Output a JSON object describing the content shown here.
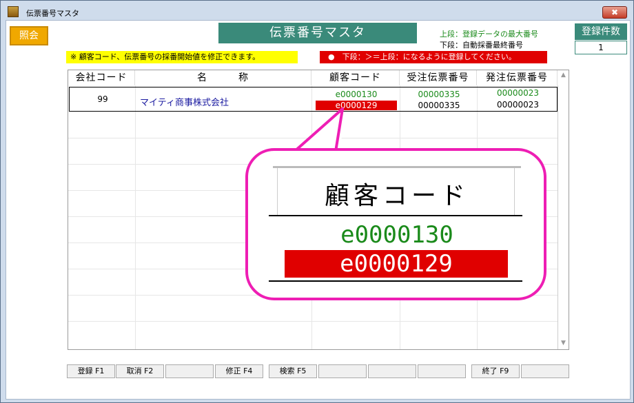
{
  "window": {
    "title": "伝票番号マスタ",
    "close_label": "✖"
  },
  "toolbar": {
    "shokai_label": "照会"
  },
  "header": {
    "title": "伝票番号マスタ",
    "legend_top": "上段：登録データの最大番号",
    "legend_bottom": "下段：自動採番最終番号",
    "count_label": "登録件数",
    "count_value": "1"
  },
  "notes": {
    "yellow": "※ 顧客コード、伝票番号の採番開始値を修正できます。",
    "red": "●　下段：＞＝上段：になるように登録してください。"
  },
  "table": {
    "columns": [
      "会社コード",
      "名　　　称",
      "顧客コード",
      "受注伝票番号",
      "発注伝票番号"
    ],
    "row": {
      "company_code": "99",
      "name": "マイティ商事株式会社",
      "customer_code_max": "e0000130",
      "customer_code_last": "e0000129",
      "order_no_max": "00000335",
      "order_no_last": "00000335",
      "purchase_no_max": "00000023",
      "purchase_no_last": "00000023"
    }
  },
  "callout": {
    "header": "顧客コード",
    "value_max": "e0000130",
    "value_last": "e0000129"
  },
  "fkeys": [
    "登録 F1",
    "取消 F2",
    "",
    "修正 F4",
    "検索 F5",
    "",
    "",
    "",
    "終了 F9",
    ""
  ],
  "colors": {
    "teal": "#3a8a7a",
    "yellow": "#ffff00",
    "red": "#e00000",
    "magenta": "#ee1eb4",
    "green": "#1a8a1a",
    "blue": "#1a1aa0"
  }
}
